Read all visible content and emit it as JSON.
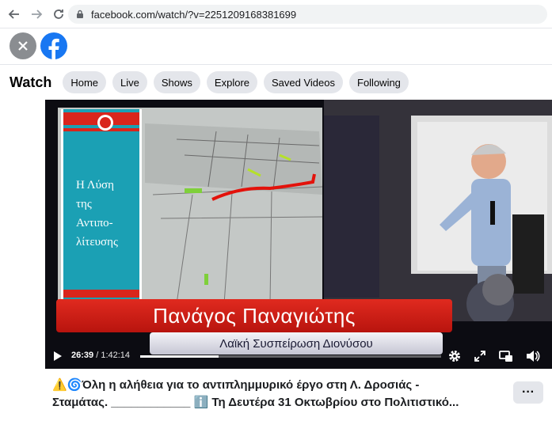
{
  "browser": {
    "url": "facebook.com/watch/?v=2251209168381699"
  },
  "watch": {
    "title": "Watch",
    "tabs": [
      {
        "label": "Home"
      },
      {
        "label": "Live"
      },
      {
        "label": "Shows"
      },
      {
        "label": "Explore"
      },
      {
        "label": "Saved Videos"
      },
      {
        "label": "Following"
      }
    ]
  },
  "video": {
    "slide_lines": [
      "Η Λύση",
      "της",
      "Αντιπο-",
      "λίτευσης"
    ],
    "speaker_name": "Πανάγος Παναγιώτης",
    "speaker_party": "Λαϊκή Συσπείρωση Διονύσου",
    "current_time": "26:39",
    "duration": "1:42:14",
    "progress": 0.26
  },
  "post": {
    "caption_line1": "⚠️🌀Όλη η αλήθεια για το αντιπλημμυρικό έργο στη Λ. Δροσιάς -",
    "caption_line2": "Σταμάτας. ____________ ℹ️ Τη Δευτέρα 31 Οκτωβρίου στο Πολιτιστικό...",
    "more_label": "···"
  },
  "colors": {
    "fb_blue": "#1877f2",
    "banner_red": "#d9251c",
    "slide_teal": "#1ba0b4"
  }
}
